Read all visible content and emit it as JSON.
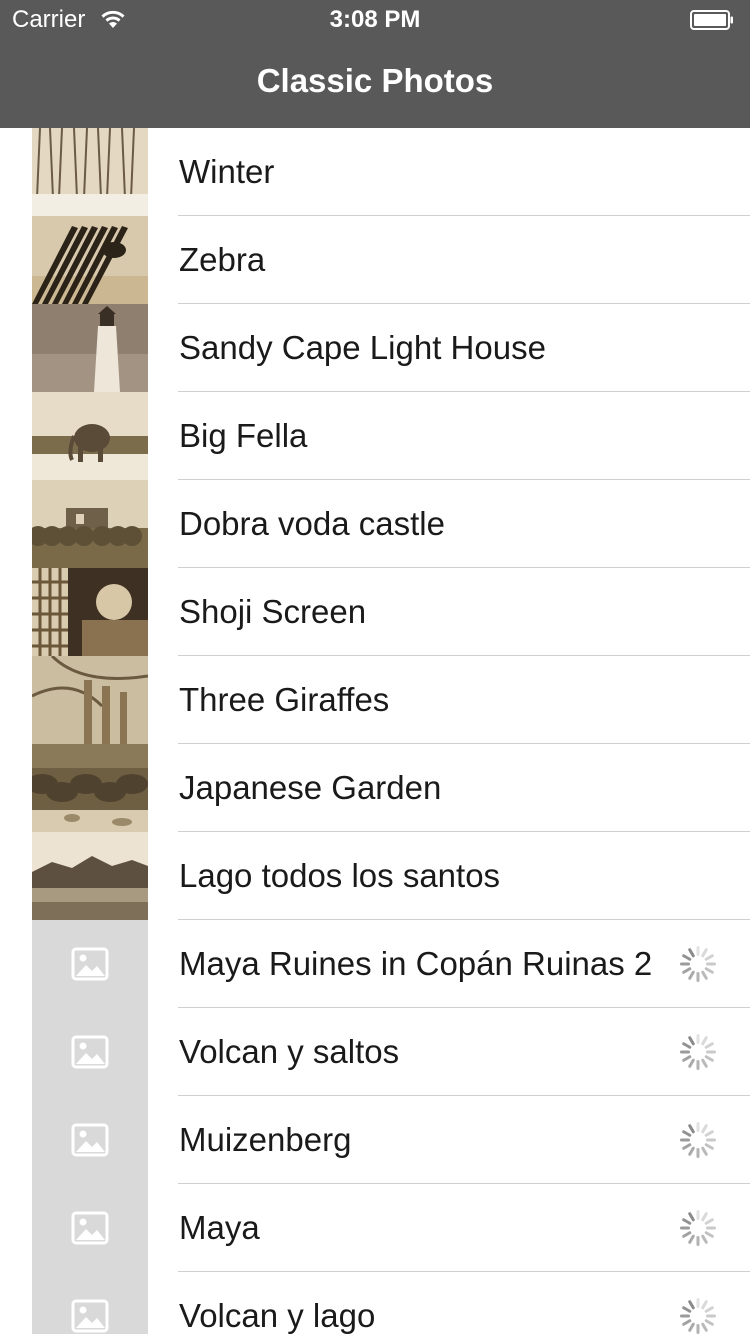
{
  "status_bar": {
    "carrier": "Carrier",
    "time": "3:08 PM"
  },
  "nav": {
    "title": "Classic Photos"
  },
  "photos": [
    {
      "title": "Winter",
      "loaded": true,
      "icon": "photo-thumbnail"
    },
    {
      "title": "Zebra",
      "loaded": true,
      "icon": "photo-thumbnail"
    },
    {
      "title": "Sandy Cape Light House",
      "loaded": true,
      "icon": "photo-thumbnail"
    },
    {
      "title": "Big Fella",
      "loaded": true,
      "icon": "photo-thumbnail"
    },
    {
      "title": "Dobra voda castle",
      "loaded": true,
      "icon": "photo-thumbnail"
    },
    {
      "title": "Shoji Screen",
      "loaded": true,
      "icon": "photo-thumbnail"
    },
    {
      "title": "Three Giraffes",
      "loaded": true,
      "icon": "photo-thumbnail"
    },
    {
      "title": "Japanese Garden",
      "loaded": true,
      "icon": "photo-thumbnail"
    },
    {
      "title": "Lago todos los santos",
      "loaded": true,
      "icon": "photo-thumbnail"
    },
    {
      "title": "Maya Ruines in Copán Ruinas 2",
      "loaded": false,
      "icon": "image-placeholder-icon"
    },
    {
      "title": "Volcan y saltos",
      "loaded": false,
      "icon": "image-placeholder-icon"
    },
    {
      "title": "Muizenberg",
      "loaded": false,
      "icon": "image-placeholder-icon"
    },
    {
      "title": "Maya",
      "loaded": false,
      "icon": "image-placeholder-icon"
    },
    {
      "title": "Volcan y lago",
      "loaded": false,
      "icon": "image-placeholder-icon"
    }
  ],
  "colors": {
    "nav_bg": "#595959",
    "placeholder_bg": "#d9d9d9",
    "separator": "#cfcfcf"
  }
}
